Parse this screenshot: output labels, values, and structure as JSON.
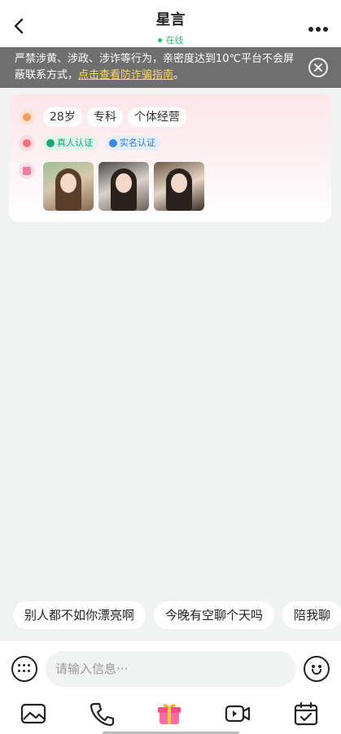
{
  "header": {
    "title": "星言",
    "status": "在线",
    "status_color": "#2bbf78"
  },
  "warning": {
    "text_before": "严禁涉黄、涉政、涉诈等行为，亲密度达到10℃平台不会屏蔽联系方式，",
    "link": "点击查看防诈骗指南",
    "text_after": "。"
  },
  "profile": {
    "tags": [
      "28岁",
      "专科",
      "个体经营"
    ],
    "badges": {
      "real_person": "真人认证",
      "real_name": "实名认证"
    },
    "photo_count": 3
  },
  "quick_replies": [
    "别人都不如你漂亮啊",
    "今晚有空聊个天吗",
    "陪我聊"
  ],
  "input": {
    "placeholder": "请输入信息···"
  },
  "toolbar": {
    "icons": [
      "image-icon",
      "phone-icon",
      "gift-icon",
      "video-call-icon",
      "calendar-check-icon"
    ]
  },
  "colors": {
    "accent_green": "#2bbf78",
    "warning_bg": "#6f6f6f",
    "warning_link": "#ffd95a"
  }
}
